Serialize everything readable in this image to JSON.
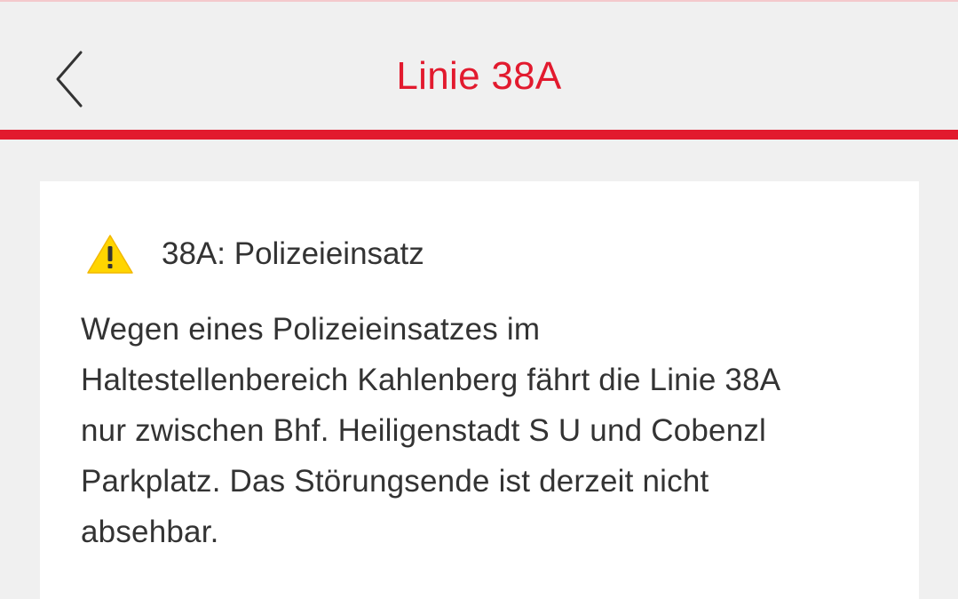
{
  "header": {
    "title": "Linie 38A",
    "back_icon": "chevron-left-icon"
  },
  "colors": {
    "accent": "#e21a2e",
    "background": "#f0f0f0",
    "card": "#ffffff",
    "text": "#333333",
    "warning": "#ffd500"
  },
  "notice": {
    "icon": "warning-icon",
    "title": "38A: Polizeieinsatz",
    "body_lines": [
      "Wegen eines Polizeieinsatzes im",
      "Haltestellenbereich Kahlenberg fährt die Linie 38A",
      "nur zwischen Bhf. Heiligenstadt S U und Cobenzl",
      "Parkplatz. Das Störungsende ist derzeit nicht",
      "absehbar."
    ]
  }
}
